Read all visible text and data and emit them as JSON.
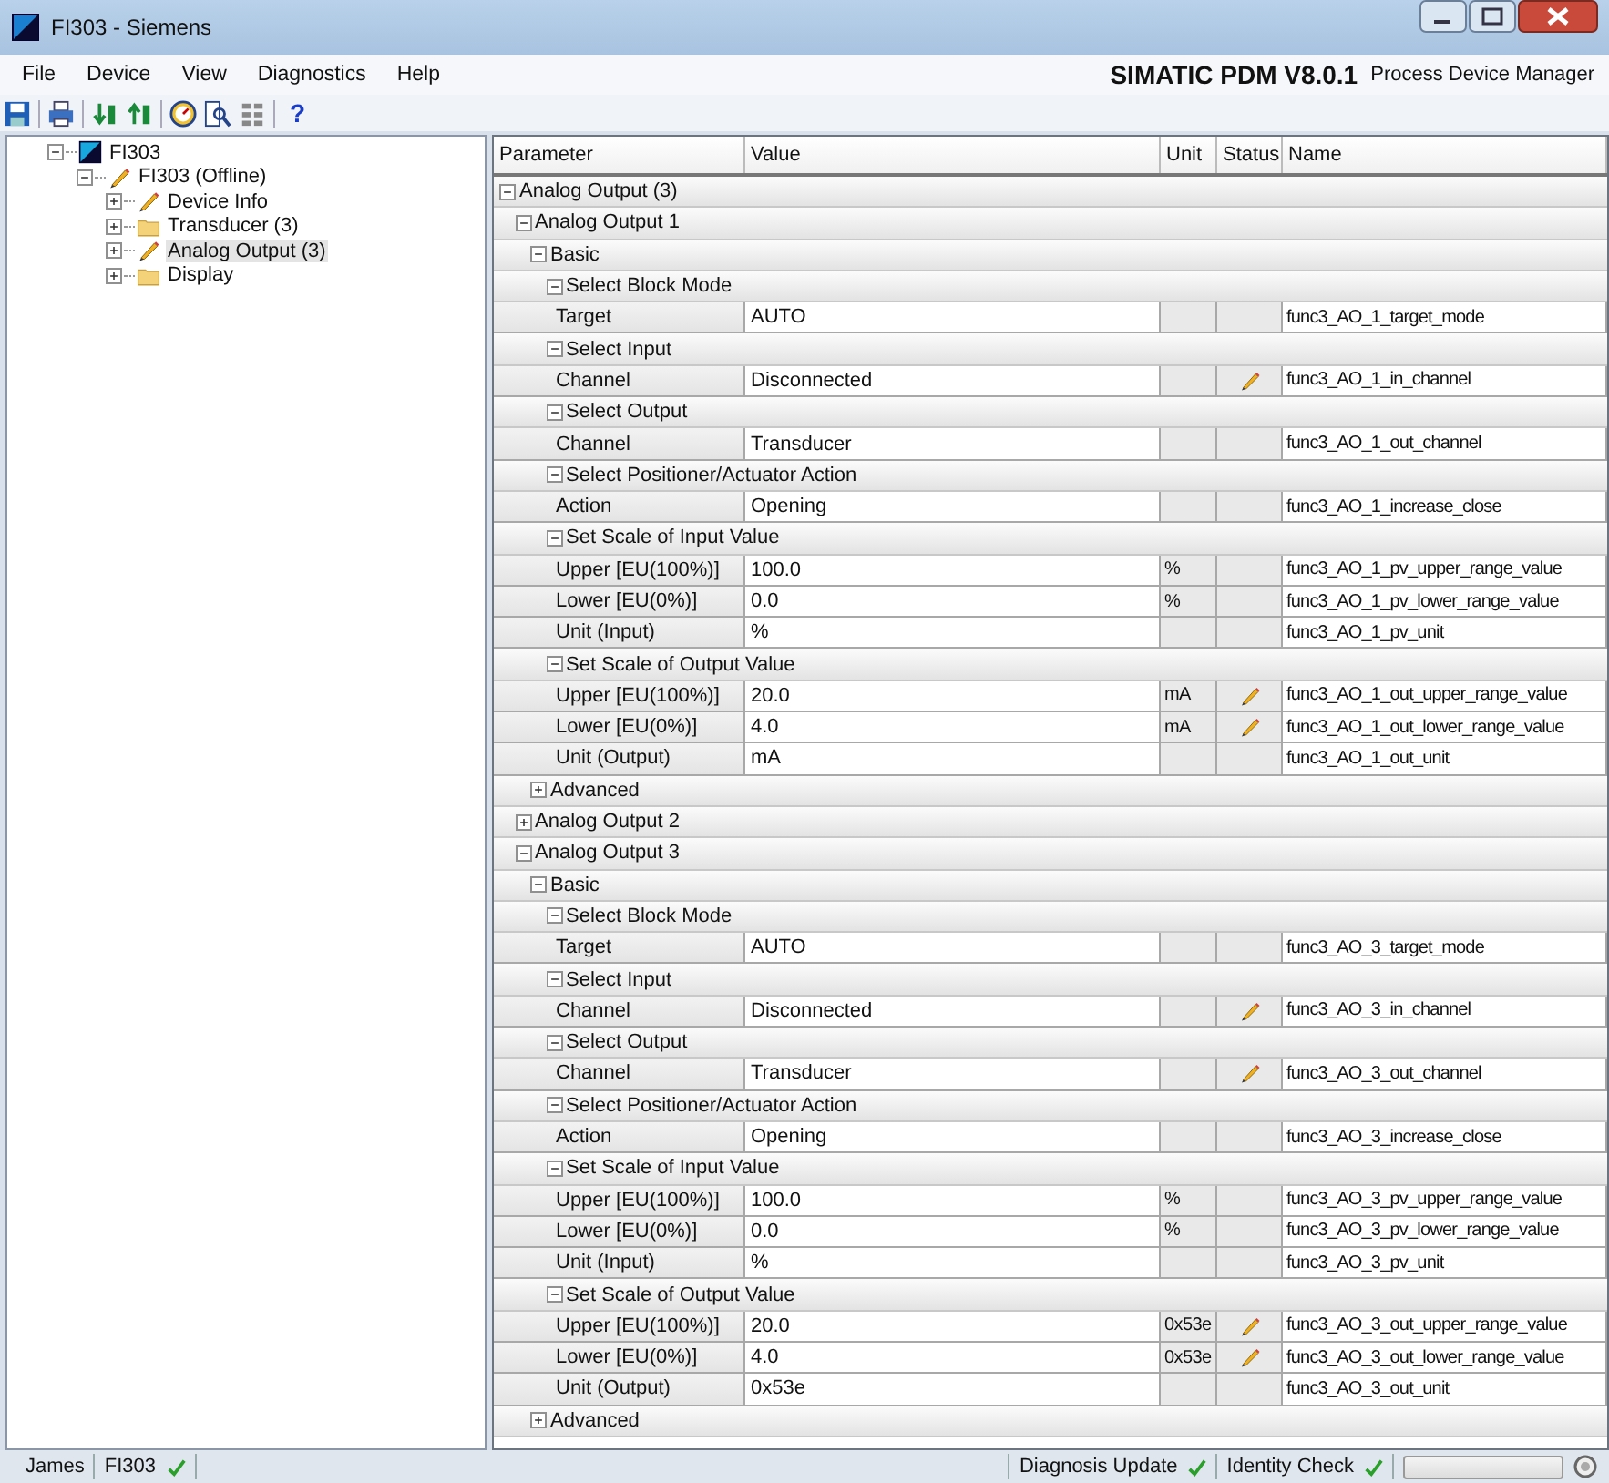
{
  "window": {
    "title": "FI303 - Siemens"
  },
  "menu": [
    "File",
    "Device",
    "View",
    "Diagnostics",
    "Help"
  ],
  "brand": {
    "product": "SIMATIC PDM V8.0.1",
    "subtitle": "Process Device Manager"
  },
  "toolbar": {
    "help": "?"
  },
  "tree": [
    {
      "label": "FI303",
      "kind": "device",
      "expanded": true,
      "selected": false,
      "children": [
        {
          "label": "FI303 (Offline)",
          "kind": "pencil",
          "expanded": true,
          "selected": false,
          "children": [
            {
              "label": "Device Info",
              "kind": "pencil",
              "expanded": false,
              "selected": false
            },
            {
              "label": "Transducer (3)",
              "kind": "folder",
              "expanded": false,
              "selected": false
            },
            {
              "label": "Analog Output (3)",
              "kind": "pencil",
              "expanded": false,
              "selected": true
            },
            {
              "label": "Display",
              "kind": "folder",
              "expanded": false,
              "selected": false
            }
          ]
        }
      ]
    }
  ],
  "table": {
    "columns": [
      "Parameter",
      "Value",
      "Unit",
      "Status",
      "Name"
    ],
    "rows": [
      {
        "kind": "group",
        "label": "Analog Output (3)",
        "expanded": true,
        "children": [
          {
            "kind": "group",
            "label": "Analog Output 1",
            "expanded": true,
            "children": [
              {
                "kind": "group",
                "label": "Basic",
                "expanded": true,
                "children": [
                  {
                    "kind": "group",
                    "label": "Select Block Mode",
                    "expanded": true,
                    "children": [
                      {
                        "kind": "param",
                        "parameter": "Target",
                        "value": "AUTO",
                        "modified": false,
                        "name": "func3_AO_1_target_mode"
                      }
                    ]
                  },
                  {
                    "kind": "group",
                    "label": "Select Input",
                    "expanded": true,
                    "children": [
                      {
                        "kind": "param",
                        "parameter": "Channel",
                        "value": "Disconnected",
                        "modified": true,
                        "name": "func3_AO_1_in_channel"
                      }
                    ]
                  },
                  {
                    "kind": "group",
                    "label": "Select Output",
                    "expanded": true,
                    "children": [
                      {
                        "kind": "param",
                        "parameter": "Channel",
                        "value": "Transducer",
                        "modified": false,
                        "name": "func3_AO_1_out_channel"
                      }
                    ]
                  },
                  {
                    "kind": "group",
                    "label": "Select Positioner/Actuator Action",
                    "expanded": true,
                    "children": [
                      {
                        "kind": "param",
                        "parameter": "Action",
                        "value": "Opening",
                        "modified": false,
                        "name": "func3_AO_1_increase_close"
                      }
                    ]
                  },
                  {
                    "kind": "group",
                    "label": "Set Scale of Input Value",
                    "expanded": true,
                    "children": [
                      {
                        "kind": "param",
                        "parameter": "Upper [EU(100%)]",
                        "value": "100.0",
                        "unit": "%",
                        "modified": false,
                        "name": "func3_AO_1_pv_upper_range_value"
                      },
                      {
                        "kind": "param",
                        "parameter": "Lower [EU(0%)]",
                        "value": "0.0",
                        "unit": "%",
                        "modified": false,
                        "name": "func3_AO_1_pv_lower_range_value"
                      },
                      {
                        "kind": "param",
                        "parameter": "Unit (Input)",
                        "value": "%",
                        "modified": false,
                        "name": "func3_AO_1_pv_unit"
                      }
                    ]
                  },
                  {
                    "kind": "group",
                    "label": "Set Scale of Output Value",
                    "expanded": true,
                    "children": [
                      {
                        "kind": "param",
                        "parameter": "Upper [EU(100%)]",
                        "value": "20.0",
                        "unit": "mA",
                        "modified": true,
                        "name": "func3_AO_1_out_upper_range_value"
                      },
                      {
                        "kind": "param",
                        "parameter": "Lower [EU(0%)]",
                        "value": "4.0",
                        "unit": "mA",
                        "modified": true,
                        "name": "func3_AO_1_out_lower_range_value"
                      },
                      {
                        "kind": "param",
                        "parameter": "Unit (Output)",
                        "value": "mA",
                        "modified": false,
                        "name": "func3_AO_1_out_unit"
                      }
                    ]
                  }
                ]
              },
              {
                "kind": "group",
                "label": "Advanced",
                "expanded": false
              }
            ]
          },
          {
            "kind": "group",
            "label": "Analog Output 2",
            "expanded": false
          },
          {
            "kind": "group",
            "label": "Analog Output 3",
            "expanded": true,
            "children": [
              {
                "kind": "group",
                "label": "Basic",
                "expanded": true,
                "children": [
                  {
                    "kind": "group",
                    "label": "Select Block Mode",
                    "expanded": true,
                    "children": [
                      {
                        "kind": "param",
                        "parameter": "Target",
                        "value": "AUTO",
                        "modified": false,
                        "name": "func3_AO_3_target_mode"
                      }
                    ]
                  },
                  {
                    "kind": "group",
                    "label": "Select Input",
                    "expanded": true,
                    "children": [
                      {
                        "kind": "param",
                        "parameter": "Channel",
                        "value": "Disconnected",
                        "modified": true,
                        "name": "func3_AO_3_in_channel"
                      }
                    ]
                  },
                  {
                    "kind": "group",
                    "label": "Select Output",
                    "expanded": true,
                    "children": [
                      {
                        "kind": "param",
                        "parameter": "Channel",
                        "value": "Transducer",
                        "modified": true,
                        "name": "func3_AO_3_out_channel"
                      }
                    ]
                  },
                  {
                    "kind": "group",
                    "label": "Select Positioner/Actuator Action",
                    "expanded": true,
                    "children": [
                      {
                        "kind": "param",
                        "parameter": "Action",
                        "value": "Opening",
                        "modified": false,
                        "name": "func3_AO_3_increase_close"
                      }
                    ]
                  },
                  {
                    "kind": "group",
                    "label": "Set Scale of Input Value",
                    "expanded": true,
                    "children": [
                      {
                        "kind": "param",
                        "parameter": "Upper [EU(100%)]",
                        "value": "100.0",
                        "unit": "%",
                        "modified": false,
                        "name": "func3_AO_3_pv_upper_range_value"
                      },
                      {
                        "kind": "param",
                        "parameter": "Lower [EU(0%)]",
                        "value": "0.0",
                        "unit": "%",
                        "modified": false,
                        "name": "func3_AO_3_pv_lower_range_value"
                      },
                      {
                        "kind": "param",
                        "parameter": "Unit (Input)",
                        "value": "%",
                        "modified": false,
                        "name": "func3_AO_3_pv_unit"
                      }
                    ]
                  },
                  {
                    "kind": "group",
                    "label": "Set Scale of Output Value",
                    "expanded": true,
                    "children": [
                      {
                        "kind": "param",
                        "parameter": "Upper [EU(100%)]",
                        "value": "20.0",
                        "unit": "0x53e",
                        "modified": true,
                        "name": "func3_AO_3_out_upper_range_value"
                      },
                      {
                        "kind": "param",
                        "parameter": "Lower [EU(0%)]",
                        "value": "4.0",
                        "unit": "0x53e",
                        "modified": true,
                        "name": "func3_AO_3_out_lower_range_value"
                      },
                      {
                        "kind": "param",
                        "parameter": "Unit (Output)",
                        "value": "0x53e",
                        "modified": false,
                        "name": "func3_AO_3_out_unit"
                      }
                    ]
                  }
                ]
              },
              {
                "kind": "group",
                "label": "Advanced",
                "expanded": false
              }
            ]
          }
        ]
      }
    ]
  },
  "status_bar": {
    "user": "James",
    "device": "FI303",
    "device_ok": true,
    "items": [
      {
        "label": "Diagnosis Update",
        "ok": true
      },
      {
        "label": "Identity Check",
        "ok": true
      }
    ],
    "progress": {
      "level": 0
    }
  }
}
